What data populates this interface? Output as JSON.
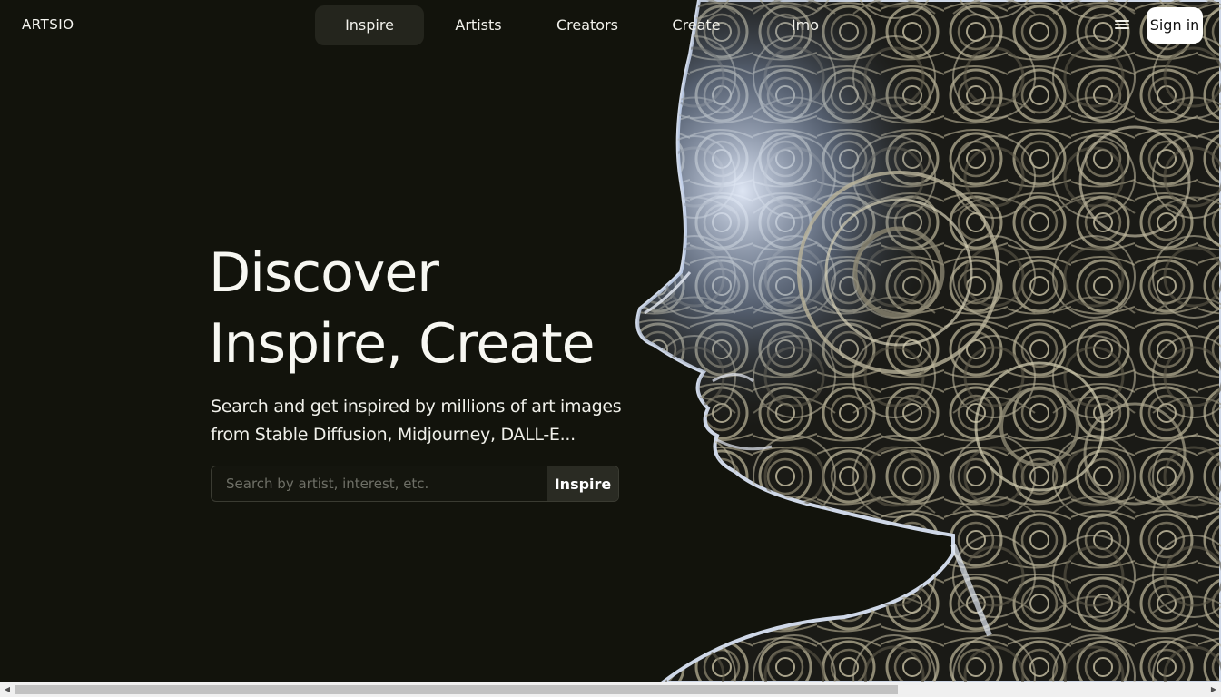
{
  "brand": {
    "logo_text": "ARTSIO"
  },
  "nav": {
    "items": [
      {
        "label": "Inspire",
        "active": true
      },
      {
        "label": "Artists",
        "active": false
      },
      {
        "label": "Creators",
        "active": false
      },
      {
        "label": "Create",
        "active": false
      },
      {
        "label": "Imo",
        "active": false
      }
    ],
    "menu_icon": "hamburger-menu-icon",
    "signin_label": "Sign in"
  },
  "hero": {
    "title_line1": "Discover",
    "title_line2": "Inspire, Create",
    "subtitle_line1": "Search and get inspired by millions of art images",
    "subtitle_line2": "from Stable Diffusion, Midjourney, DALL-E...",
    "search": {
      "placeholder": "Search by artist, interest, etc.",
      "value": "",
      "button_label": "Inspire"
    }
  },
  "colors": {
    "background": "#12130c",
    "text": "#f3f3ee",
    "nav_active_bg": "#24251d",
    "signin_bg": "#ffffff",
    "search_button_bg": "#2a2b23"
  }
}
